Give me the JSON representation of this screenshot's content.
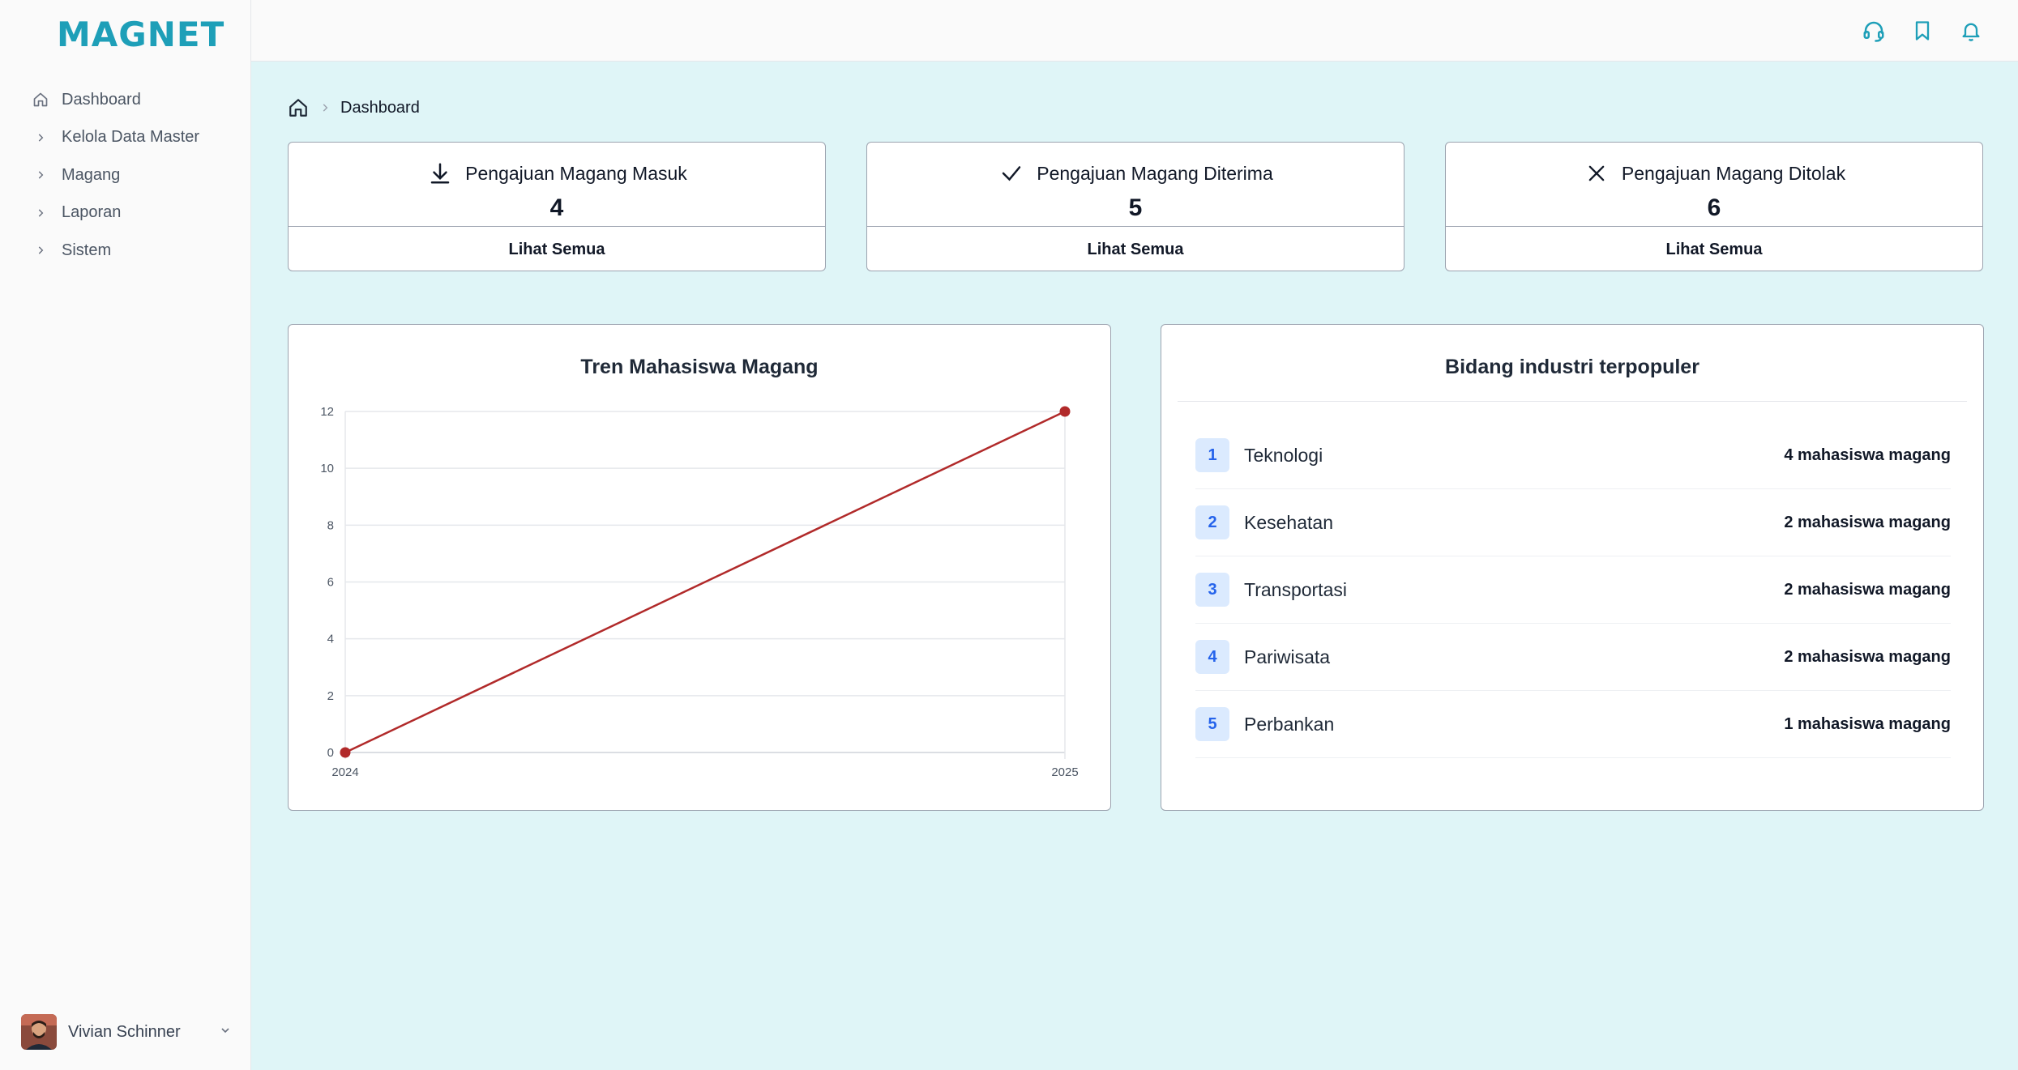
{
  "app": {
    "logo": "MAGNET"
  },
  "sidebar": {
    "items": [
      {
        "label": "Dashboard",
        "icon": "home-icon"
      },
      {
        "label": "Kelola Data Master",
        "icon": "chevron-right-icon"
      },
      {
        "label": "Magang",
        "icon": "chevron-right-icon"
      },
      {
        "label": "Laporan",
        "icon": "chevron-right-icon"
      },
      {
        "label": "Sistem",
        "icon": "chevron-right-icon"
      }
    ],
    "user": {
      "name": "Vivian Schinner"
    }
  },
  "header": {
    "icons": [
      "headset-icon",
      "bookmark-icon",
      "bell-icon"
    ]
  },
  "breadcrumb": {
    "current": "Dashboard"
  },
  "stats": [
    {
      "title": "Pengajuan Magang Masuk",
      "value": "4",
      "link": "Lihat Semua",
      "icon": "download-icon"
    },
    {
      "title": "Pengajuan Magang Diterima",
      "value": "5",
      "link": "Lihat Semua",
      "icon": "check-icon"
    },
    {
      "title": "Pengajuan Magang Ditolak",
      "value": "6",
      "link": "Lihat Semua",
      "icon": "x-icon"
    }
  ],
  "trend": {
    "title": "Tren Mahasiswa Magang"
  },
  "chart_data": {
    "type": "line",
    "title": "Tren Mahasiswa Magang",
    "x": [
      "2024",
      "2025"
    ],
    "series": [
      {
        "values": [
          0,
          12
        ],
        "color": "#b12a2a"
      }
    ],
    "ylim": [
      0,
      12
    ],
    "yticks": [
      0,
      2,
      4,
      6,
      8,
      10,
      12
    ],
    "grid": true,
    "xlabel": "",
    "ylabel": ""
  },
  "industries": {
    "title": "Bidang industri terpopuler",
    "items": [
      {
        "rank": "1",
        "name": "Teknologi",
        "count": "4 mahasiswa magang"
      },
      {
        "rank": "2",
        "name": "Kesehatan",
        "count": "2 mahasiswa magang"
      },
      {
        "rank": "3",
        "name": "Transportasi",
        "count": "2 mahasiswa magang"
      },
      {
        "rank": "4",
        "name": "Pariwisata",
        "count": "2 mahasiswa magang"
      },
      {
        "rank": "5",
        "name": "Perbankan",
        "count": "1 mahasiswa magang"
      }
    ]
  },
  "colors": {
    "accent": "#1e9fb8",
    "background": "#dff5f7",
    "line": "#b12a2a"
  }
}
